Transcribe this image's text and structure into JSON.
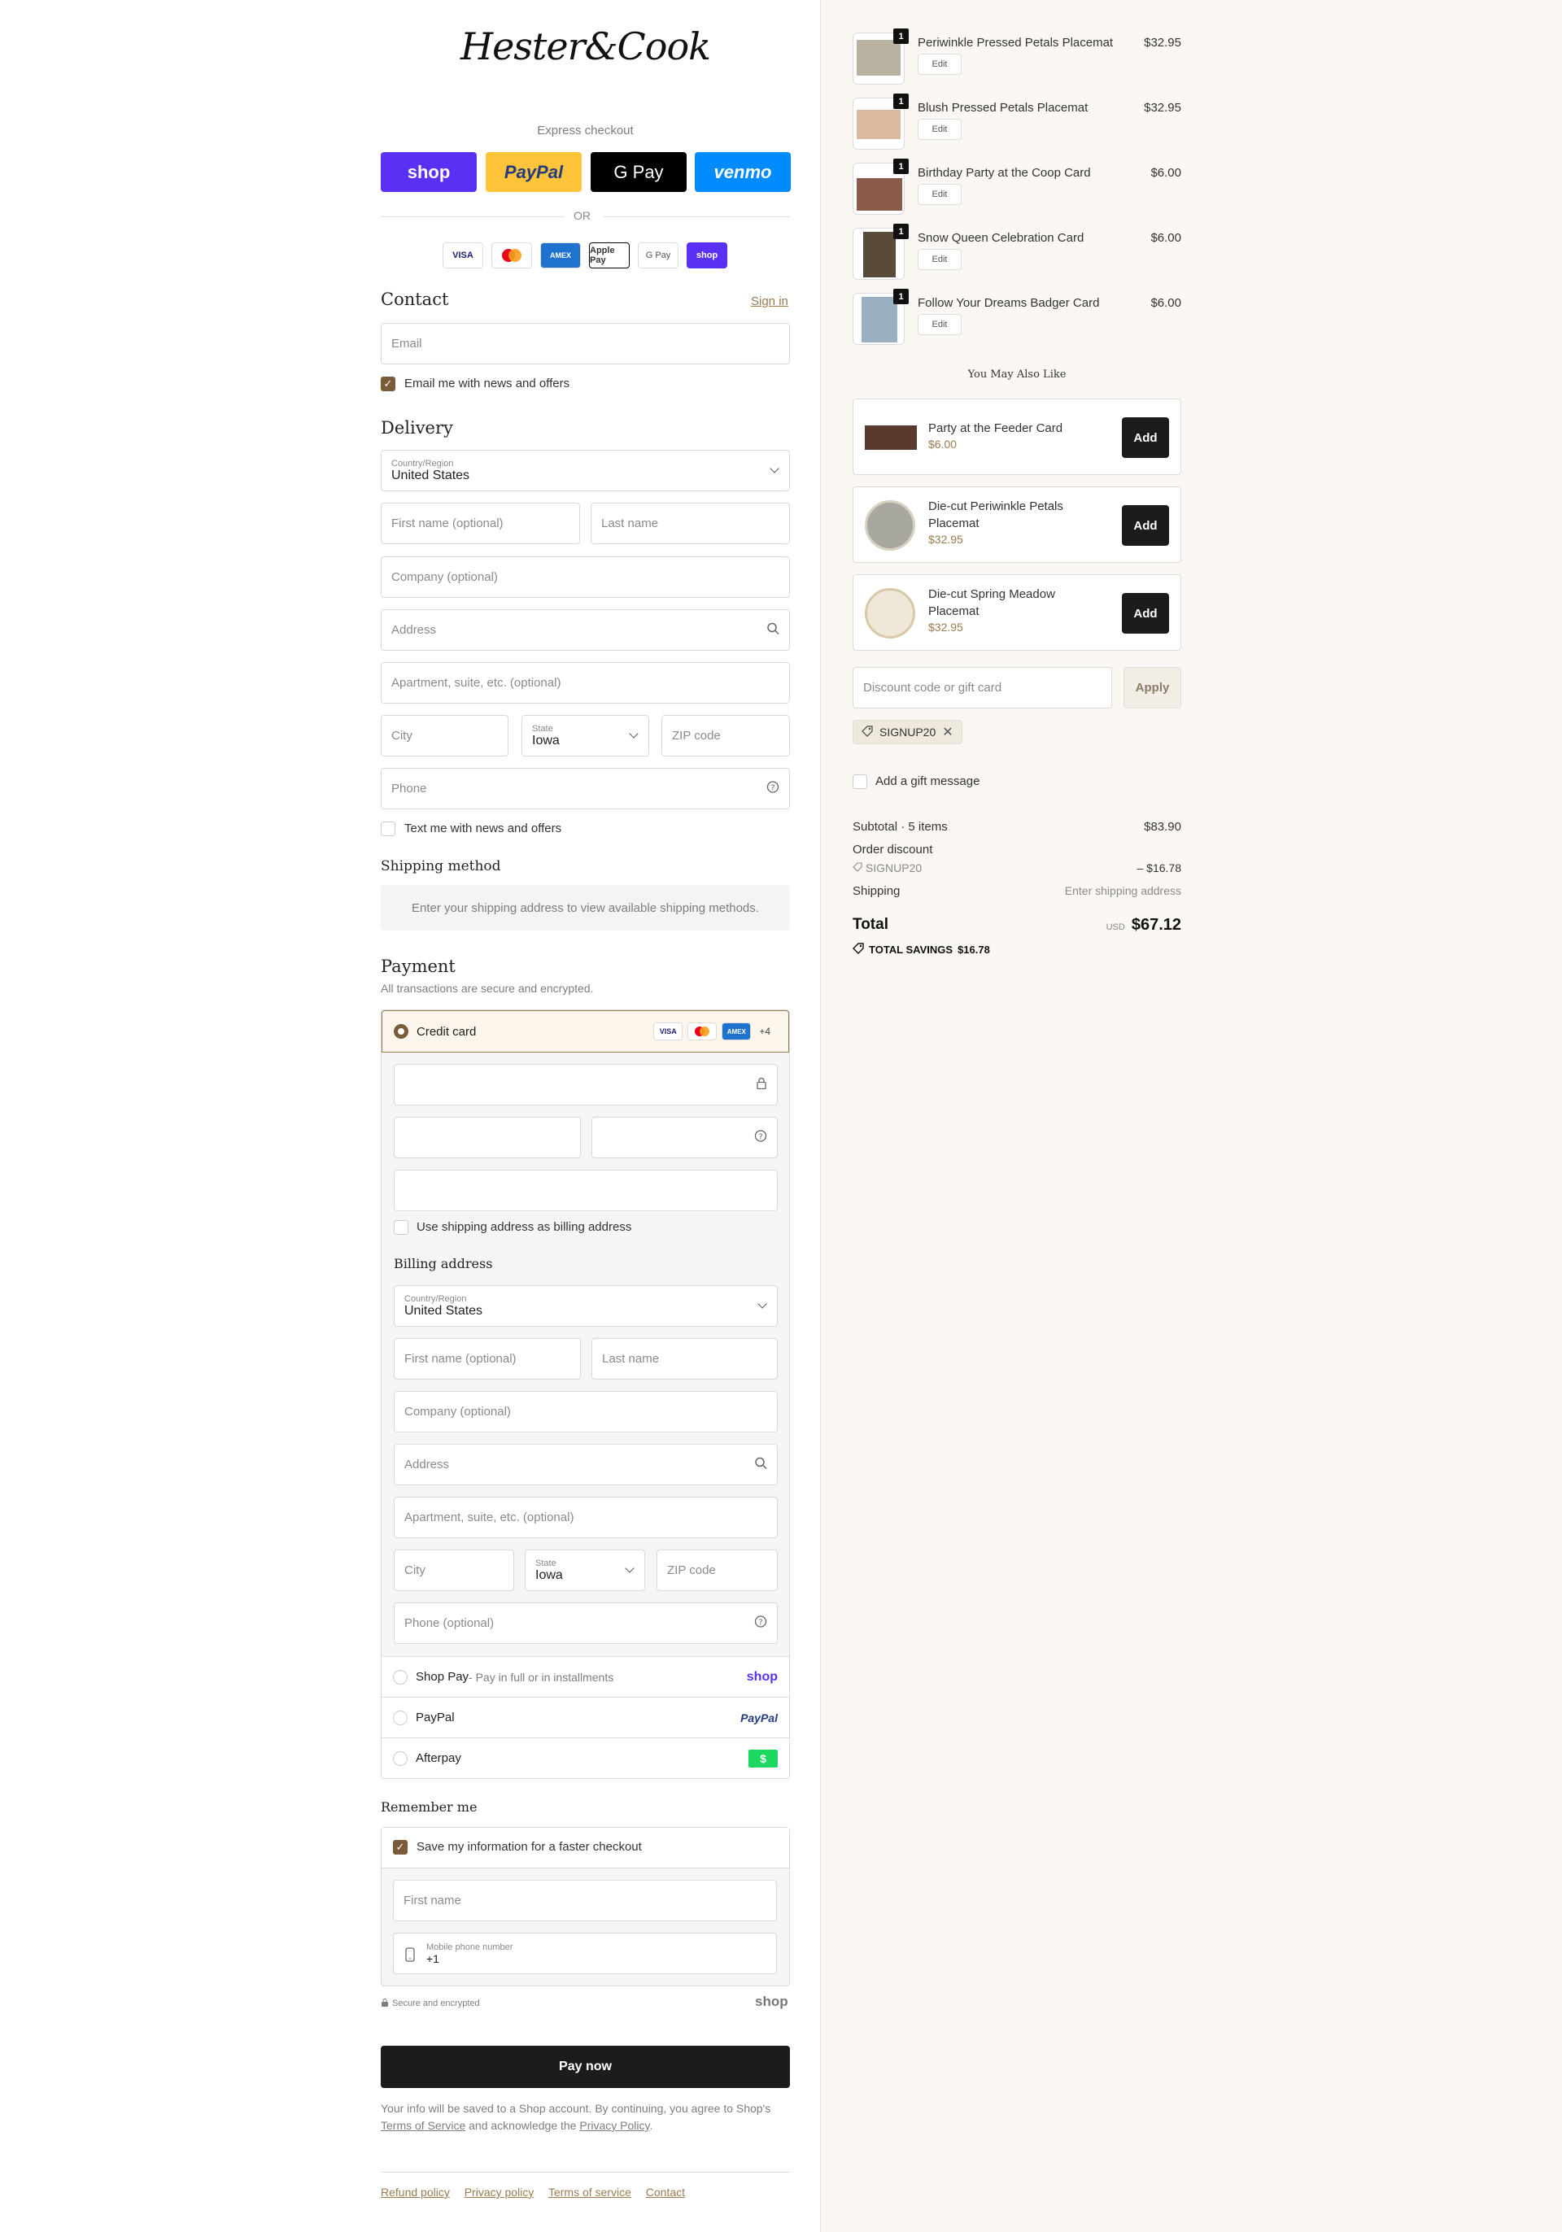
{
  "brand": {
    "logo_text": "Hester&Cook"
  },
  "express": {
    "label": "Express checkout",
    "buttons": {
      "shop": "shop",
      "paypal": "PayPal",
      "gpay": "G Pay",
      "venmo": "venmo"
    },
    "or_text": "OR",
    "card_logos": [
      "VISA",
      "MC",
      "AMEX",
      "Apple Pay",
      "G Pay",
      "shop"
    ]
  },
  "contact": {
    "title": "Contact",
    "signin": "Sign in",
    "email_placeholder": "Email",
    "news_label": "Email me with news and offers"
  },
  "delivery": {
    "title": "Delivery",
    "country_label": "Country/Region",
    "country_value": "United States",
    "first_name": "First name (optional)",
    "last_name": "Last name",
    "company": "Company (optional)",
    "address": "Address",
    "apartment": "Apartment, suite, etc. (optional)",
    "city": "City",
    "state_label": "State",
    "state_value": "Iowa",
    "zip": "ZIP code",
    "phone": "Phone",
    "text_label": "Text me with news and offers"
  },
  "shipping": {
    "title": "Shipping method",
    "message": "Enter your shipping address to view available shipping methods."
  },
  "payment": {
    "title": "Payment",
    "subtitle": "All transactions are secure and encrypted.",
    "credit_card": "Credit card",
    "card_logos": [
      "VISA",
      "MC",
      "AMEX"
    ],
    "more_cards": "+4",
    "use_shipping": "Use shipping address as billing address",
    "billing_title": "Billing address",
    "billing": {
      "country_label": "Country/Region",
      "country_value": "United States",
      "first_name": "First name (optional)",
      "last_name": "Last name",
      "company": "Company (optional)",
      "address": "Address",
      "apartment": "Apartment, suite, etc. (optional)",
      "city": "City",
      "state_label": "State",
      "state_value": "Iowa",
      "zip": "ZIP code",
      "phone": "Phone (optional)"
    },
    "options": [
      {
        "label": "Shop Pay",
        "sub": " - Pay in full or in installments",
        "logo": "shop"
      },
      {
        "label": "PayPal",
        "sub": "",
        "logo": "PayPal"
      },
      {
        "label": "Afterpay",
        "sub": "",
        "logo": "$"
      }
    ]
  },
  "remember": {
    "title": "Remember me",
    "save_label": "Save my information for a faster checkout",
    "first_name": "First name",
    "mobile_label": "Mobile phone number",
    "mobile_value": "+1",
    "secure": "Secure and encrypted",
    "shop_logo": "shop"
  },
  "pay_now": "Pay now",
  "legal": {
    "text1": "Your info will be saved to a Shop account. By continuing, you agree to Shop's ",
    "terms": "Terms of Service",
    "text2": " and acknowledge the ",
    "privacy": "Privacy Policy",
    "text3": "."
  },
  "footer": [
    "Refund policy",
    "Privacy policy",
    "Terms of service",
    "Contact"
  ],
  "cart": {
    "items": [
      {
        "name": "Periwinkle Pressed Petals Placemat",
        "price": "$32.95",
        "qty": "1",
        "edit": "Edit",
        "color": "#b8b2a0"
      },
      {
        "name": "Blush Pressed Petals Placemat",
        "price": "$32.95",
        "qty": "1",
        "edit": "Edit",
        "color": "#d9b9a0"
      },
      {
        "name": "Birthday Party at the Coop Card",
        "price": "$6.00",
        "qty": "1",
        "edit": "Edit",
        "color": "#8a5a4a"
      },
      {
        "name": "Snow Queen Celebration Card",
        "price": "$6.00",
        "qty": "1",
        "edit": "Edit",
        "color": "#5a4a3a"
      },
      {
        "name": "Follow Your Dreams Badger Card",
        "price": "$6.00",
        "qty": "1",
        "edit": "Edit",
        "color": "#9ab0c0"
      }
    ],
    "recommend_title": "You May Also Like",
    "recommendations": [
      {
        "name": "Party at the Feeder Card",
        "price": "$6.00",
        "add": "Add"
      },
      {
        "name": "Die-cut Periwinkle Petals Placemat",
        "price": "$32.95",
        "add": "Add"
      },
      {
        "name": "Die-cut Spring Meadow Placemat",
        "price": "$32.95",
        "add": "Add"
      }
    ],
    "discount_placeholder": "Discount code or gift card",
    "apply": "Apply",
    "applied_code": "SIGNUP20",
    "gift_message": "Add a gift message",
    "summary": {
      "subtotal_label": "Subtotal · 5 items",
      "subtotal": "$83.90",
      "order_discount": "Order discount",
      "discount_code": "SIGNUP20",
      "discount_value": "– $16.78",
      "shipping_label": "Shipping",
      "shipping_value": "Enter shipping address",
      "total_label": "Total",
      "currency": "USD",
      "total": "$67.12",
      "savings_label": "TOTAL SAVINGS",
      "savings_value": "$16.78"
    }
  }
}
